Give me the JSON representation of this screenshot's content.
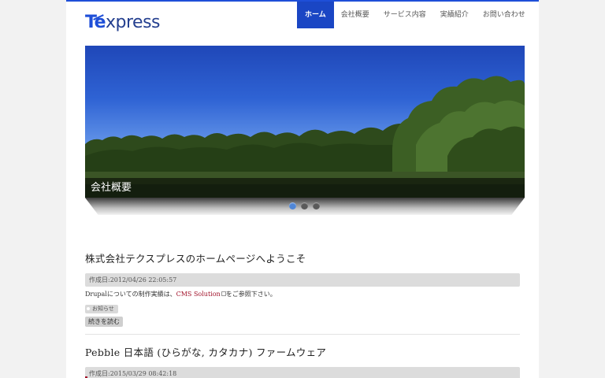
{
  "logo": {
    "first": "Te",
    "rest": "xpress"
  },
  "nav": {
    "items": [
      {
        "label": "ホーム"
      },
      {
        "label": "会社概要"
      },
      {
        "label": "サービス内容"
      },
      {
        "label": "実績紹介"
      },
      {
        "label": "お問い合わせ"
      }
    ],
    "active_index": 0
  },
  "slider": {
    "caption": "会社概要",
    "slide_count": 3,
    "active_slide": 1
  },
  "articles": [
    {
      "title": "株式会社テクスプレスのホームページへようこそ",
      "meta": "作成日:2012/04/26 22:05:57",
      "body_prefix": "Drupalについての制作実績は、",
      "body_link": "CMS Solution",
      "body_suffix": "をご参照下さい。",
      "tag": "お知らせ",
      "more": "続きを読む"
    },
    {
      "title": "Pebble 日本語 (ひらがな, カタカナ) ファームウェア",
      "meta": "作成日:2015/03/29 08:42:18"
    }
  ],
  "colors": {
    "accent": "#1a46c4",
    "link": "#a1122a"
  }
}
